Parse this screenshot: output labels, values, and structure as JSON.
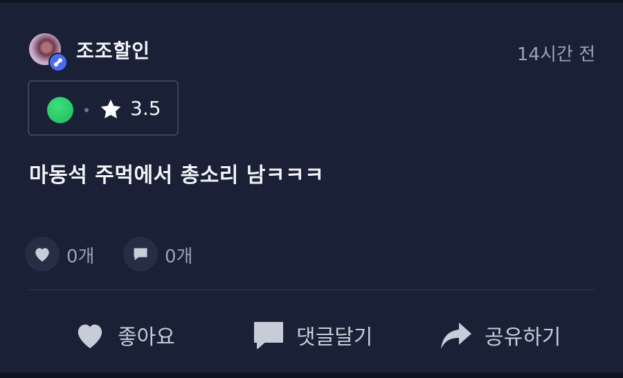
{
  "post": {
    "username": "조조할인",
    "time": "14시간 전",
    "rating": "3.5",
    "text": "마동석 주먹에서 총소리 남ㅋㅋㅋ"
  },
  "stats": {
    "likes": "0개",
    "comments": "0개"
  },
  "actions": {
    "like_label": "좋아요",
    "comment_label": "댓글달기",
    "share_label": "공유하기"
  },
  "icons": {
    "heart": "heart-icon",
    "comment": "comment-icon",
    "share": "share-icon",
    "star": "star-icon"
  },
  "colors": {
    "background": "#1a2035",
    "text_primary": "#f2f4f8",
    "text_secondary": "#9aa3b8",
    "badge_blue": "#4a6cf0",
    "green_dot": "#2ecc71"
  }
}
